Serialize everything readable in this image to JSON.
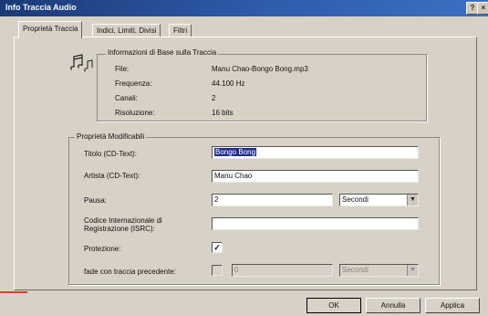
{
  "window": {
    "title": "Info Traccia Audio",
    "help_glyph": "?",
    "close_glyph": "×"
  },
  "tabs": [
    {
      "label": "Proprietà Traccia",
      "active": true
    },
    {
      "label": "Indici, Limiti, Divisi",
      "active": false
    },
    {
      "label": "Filtri",
      "active": false
    }
  ],
  "base_info": {
    "legend": "Informazioni di Base sulla Traccia",
    "rows": [
      {
        "label": "File:",
        "value": "Manu Chao-Bongo Bong.mp3"
      },
      {
        "label": "Frequenza:",
        "value": "44.100 Hz"
      },
      {
        "label": "Canali:",
        "value": "2"
      },
      {
        "label": "Risoluzione:",
        "value": "16 bits"
      }
    ]
  },
  "editable": {
    "legend": "Proprietà Modificabili",
    "title_label": "Titolo (CD-Text):",
    "title_value": "Bongo Bong",
    "artist_label": "Artista (CD-Text):",
    "artist_value": "Manu Chao",
    "pause_label": "Pausa:",
    "pause_value": "2",
    "pause_unit": "Secondi",
    "isrc_label_line1": "Codice Internazionale di",
    "isrc_label_line2": "Registrazione (ISRC):",
    "isrc_value": "",
    "protection_label": "Protezione:",
    "protection_checked": true,
    "protection_mark": "✓",
    "fade_label": "fade con traccia precedente:",
    "fade_checked": false,
    "fade_value": "0",
    "fade_unit": "Secondi"
  },
  "buttons": {
    "ok": "OK",
    "cancel": "Annulla",
    "apply": "Applica"
  },
  "colors": {
    "titlebar": "#1b3a78",
    "dialog_bg": "#d8d1c6",
    "selection": "#1f2f8c"
  }
}
